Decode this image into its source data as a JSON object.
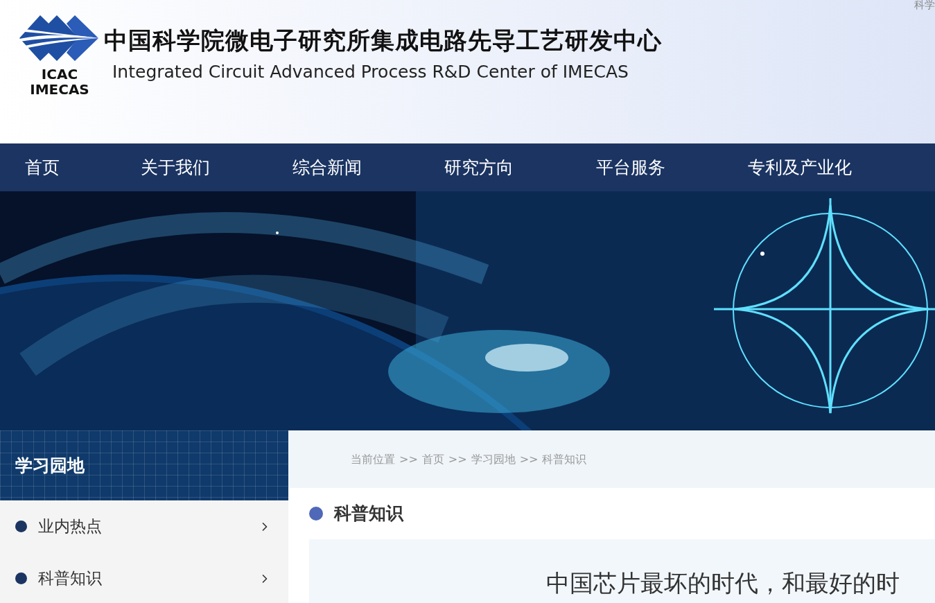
{
  "header": {
    "logo_top": "ICAC",
    "logo_bottom": "IMECAS",
    "title_cn": "中国科学院微电子研究所集成电路先导工艺研发中心",
    "title_en": "Integrated Circuit Advanced Process R&D Center of IMECAS",
    "corner_link": "科学"
  },
  "nav": [
    "首页",
    "关于我们",
    "综合新闻",
    "研究方向",
    "平台服务",
    "专利及产业化"
  ],
  "sidebar": {
    "title": "学习园地",
    "items": [
      "业内热点",
      "科普知识"
    ]
  },
  "breadcrumb": {
    "label": "当前位置",
    "separator": ">>",
    "items": [
      "首页",
      "学习园地",
      "科普知识"
    ]
  },
  "section": {
    "title": "科普知识",
    "article_title": "中国芯片最坏的时代，和最好的时"
  }
}
